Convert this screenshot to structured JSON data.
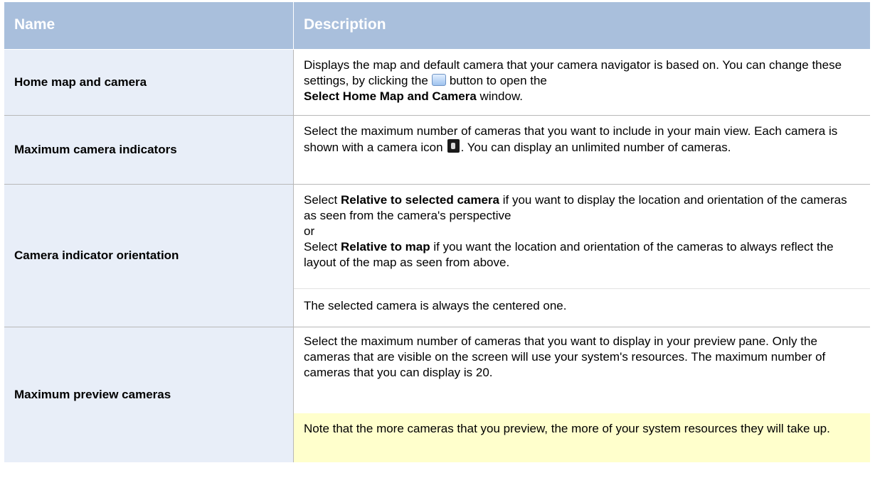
{
  "header": {
    "name": "Name",
    "description": "Description"
  },
  "rows": [
    {
      "name": "Home map and camera",
      "desc_a": "Displays the map and default camera that your camera navigator is based on. You can change these settings, by clicking the",
      "desc_b": "button to open the",
      "desc_bold": "Select Home Map and Camera",
      "desc_c": "window."
    },
    {
      "name": "Maximum camera indicators",
      "desc_a": "Select the maximum number of cameras that you want to include in your main view. Each camera is shown with a camera icon",
      "desc_b": ". You can display an unlimited number of cameras."
    },
    {
      "name": "Camera indicator orientation",
      "p1_a": "Select",
      "p1_bold": "Relative to selected camera",
      "p1_b": "if you want to display the location and orientation of the cameras as seen from the camera's perspective",
      "p1_or": "or",
      "p1_c": "Select",
      "p1_bold2": "Relative to map",
      "p1_d": "if you want the location and orientation of the cameras to always reflect the layout of the map as seen from above.",
      "p2": "The selected camera is always the centered one."
    },
    {
      "name": "Maximum preview cameras",
      "p1": "Select the maximum number of cameras that you want to display in your preview pane. Only the cameras that are visible on the screen will use your system's resources. The maximum number of cameras that you can display is 20.",
      "note": "Note that the more cameras that you preview, the more of your system resources they will take up."
    }
  ],
  "colors": {
    "header_bg": "#a9bfdc",
    "name_cell_bg": "#e8eef8",
    "note_bg": "#ffffcc",
    "border": "#b8b8b8"
  },
  "icons": {
    "row1": "browse-button-icon",
    "row2": "camera-icon"
  }
}
